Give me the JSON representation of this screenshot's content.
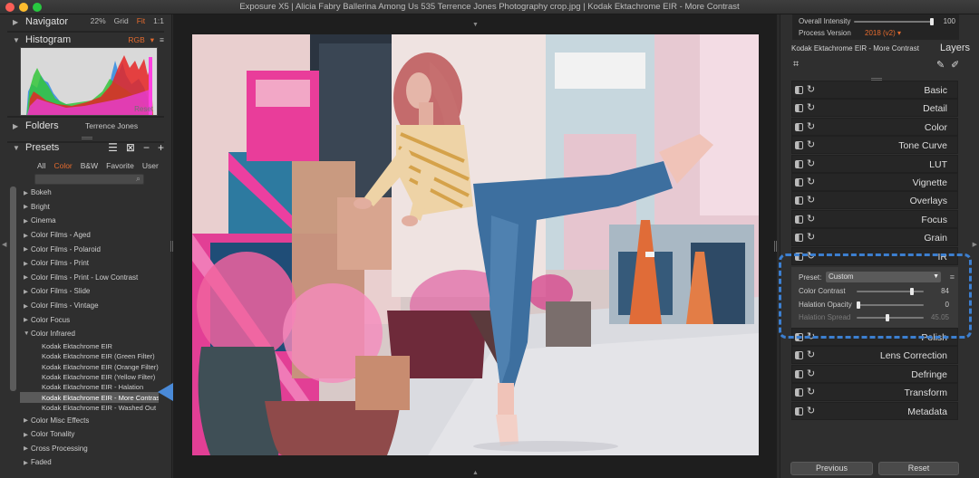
{
  "window": {
    "title": "Exposure X5 | Alicia Fabry Ballerina Among Us 535 Terrence Jones Photography crop.jpg | Kodak Ektachrome EIR - More Contrast"
  },
  "navigator": {
    "title": "Navigator",
    "zoom": "22%",
    "grid": "Grid",
    "fit": "Fit",
    "one_to_one": "1:1"
  },
  "histogram": {
    "title": "Histogram",
    "mode": "RGB",
    "reset": "Reset"
  },
  "folders": {
    "title": "Folders",
    "value": "Terrence Jones"
  },
  "presets": {
    "title": "Presets",
    "tabs": [
      "All",
      "Color",
      "B&W",
      "Favorite",
      "User"
    ],
    "active_tab": "Color",
    "search_placeholder": "",
    "categories": [
      {
        "label": "Bokeh",
        "open": false
      },
      {
        "label": "Bright",
        "open": false
      },
      {
        "label": "Cinema",
        "open": false
      },
      {
        "label": "Color Films - Aged",
        "open": false
      },
      {
        "label": "Color Films - Polaroid",
        "open": false
      },
      {
        "label": "Color Films - Print",
        "open": false
      },
      {
        "label": "Color Films - Print - Low Contrast",
        "open": false
      },
      {
        "label": "Color Films - Slide",
        "open": false
      },
      {
        "label": "Color Films - Vintage",
        "open": false
      },
      {
        "label": "Color Focus",
        "open": false
      },
      {
        "label": "Color Infrared",
        "open": true,
        "items": [
          {
            "label": "Kodak Ektachrome EIR",
            "selected": false
          },
          {
            "label": "Kodak Ektachrome EIR (Green Filter)",
            "selected": false
          },
          {
            "label": "Kodak Ektachrome EIR (Orange Filter)",
            "selected": false
          },
          {
            "label": "Kodak Ektachrome EIR (Yellow Filter)",
            "selected": false
          },
          {
            "label": "Kodak Ektachrome EIR - Halation",
            "selected": false
          },
          {
            "label": "Kodak Ektachrome EIR - More Contrast",
            "selected": true
          },
          {
            "label": "Kodak Ektachrome EIR - Washed Out",
            "selected": false
          }
        ]
      },
      {
        "label": "Color Misc Effects",
        "open": false
      },
      {
        "label": "Color Tonality",
        "open": false
      },
      {
        "label": "Cross Processing",
        "open": false
      },
      {
        "label": "Faded",
        "open": false
      }
    ]
  },
  "layer": {
    "intensity_label": "Overall Intensity",
    "intensity_value": "100",
    "intensity_fraction": 1.0,
    "process_version_label": "Process Version",
    "process_version_value": "2018 (v2)",
    "name": "Kodak Ektachrome EIR - More Contrast",
    "layers_label": "Layers"
  },
  "panels_top": [
    "Basic",
    "Detail",
    "Color",
    "Tone Curve",
    "LUT",
    "Vignette",
    "Overlays",
    "Focus",
    "Grain",
    "IR"
  ],
  "ir_panel": {
    "preset_label": "Preset:",
    "preset_value": "Custom",
    "sliders": [
      {
        "label": "Color Contrast",
        "value": "84",
        "fraction": 0.84,
        "enabled": true
      },
      {
        "label": "Halation Opacity",
        "value": "0",
        "fraction": 0.0,
        "enabled": true
      },
      {
        "label": "Halation Spread",
        "value": "45.05",
        "fraction": 0.45,
        "enabled": false
      }
    ]
  },
  "panels_bottom": [
    "Polish",
    "Lens Correction",
    "Defringe",
    "Transform",
    "Metadata"
  ],
  "buttons": {
    "previous": "Previous",
    "reset": "Reset"
  },
  "colors": {
    "accent": "#e56b2e",
    "highlight_blue": "#3c7fd0"
  }
}
